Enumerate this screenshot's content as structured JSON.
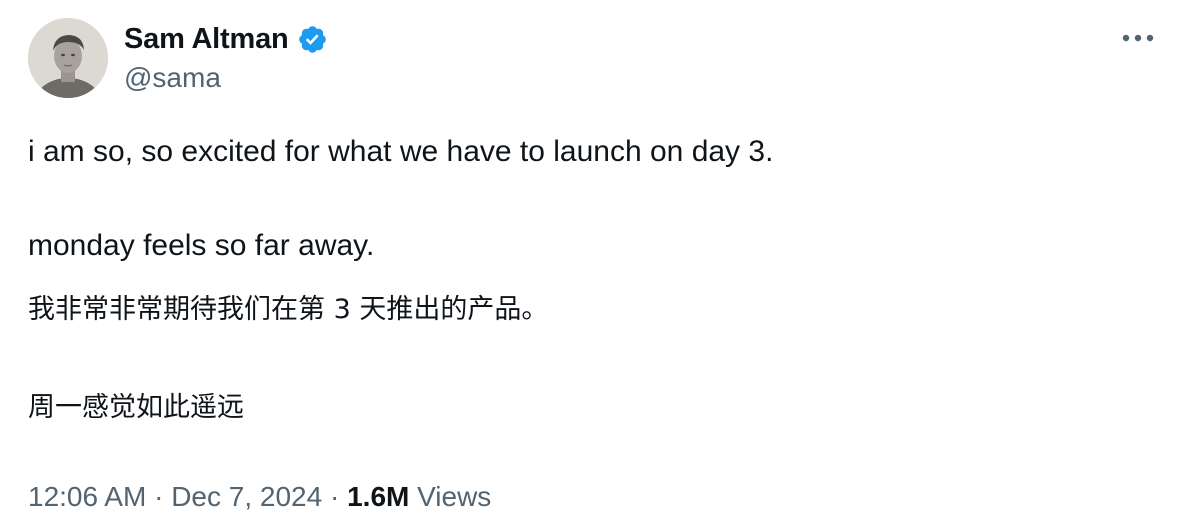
{
  "author": {
    "display_name": "Sam Altman",
    "handle": "@sama",
    "verified": true
  },
  "tweet": {
    "lines": [
      "i am so, so excited for what we have to launch on day 3.",
      "monday feels so far away.",
      "我非常非常期待我们在第 3 天推出的产品。",
      "周一感觉如此遥远"
    ],
    "time": "12:06 AM",
    "separator": "·",
    "date": "Dec 7, 2024",
    "views_count": "1.6M",
    "views_label": "Views"
  },
  "icons": {
    "verified": "verified-badge-icon",
    "more": "more-horizontal-icon"
  },
  "colors": {
    "primary_text": "#0f1419",
    "secondary_text": "#536471",
    "verified_blue": "#1d9bf0",
    "background": "#ffffff"
  }
}
